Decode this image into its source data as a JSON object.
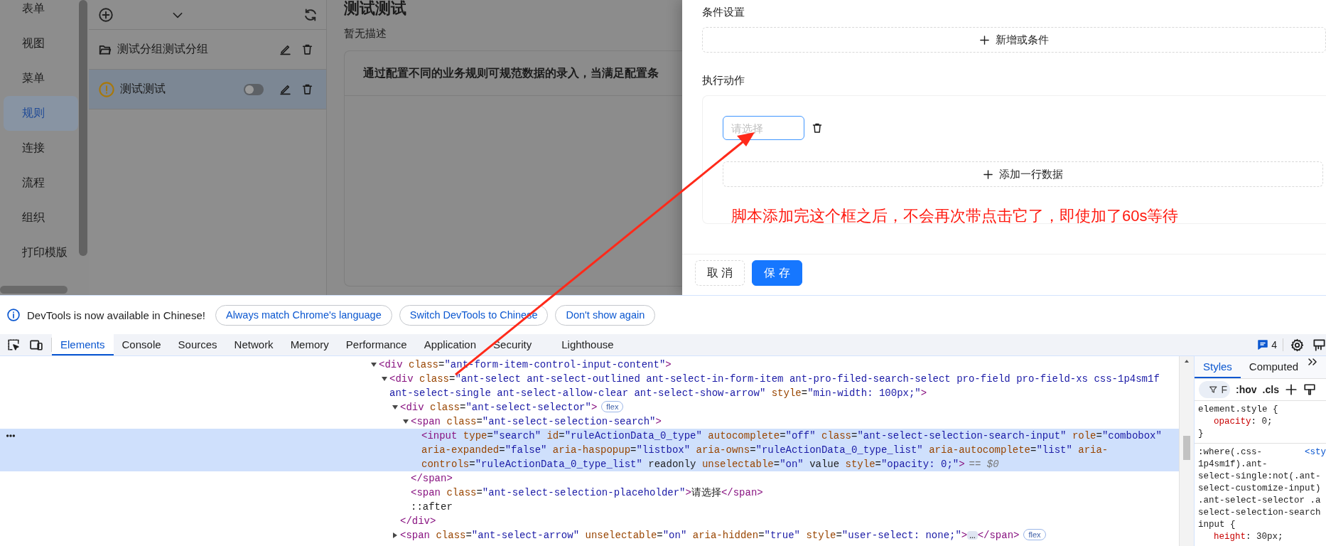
{
  "nav": {
    "items": [
      {
        "label": "表单",
        "selected": false
      },
      {
        "label": "视图",
        "selected": false
      },
      {
        "label": "菜单",
        "selected": false
      },
      {
        "label": "规则",
        "selected": true
      },
      {
        "label": "连接",
        "selected": false
      },
      {
        "label": "流程",
        "selected": false
      },
      {
        "label": "组织",
        "selected": false
      },
      {
        "label": "打印模版",
        "selected": false
      }
    ]
  },
  "rule_list": {
    "items": [
      {
        "kind": "group",
        "label": "测试分组测试分组",
        "selected": false
      },
      {
        "kind": "rule",
        "label": "测试测试",
        "selected": true,
        "enabled": false
      }
    ]
  },
  "rule": {
    "title": "测试测试",
    "description": "暂无描述",
    "notice": "通过配置不同的业务规则可规范数据的录入，当满足配置条"
  },
  "drawer": {
    "condition_label": "条件设置",
    "add_condition": "新增或条件",
    "action_label": "执行动作",
    "action_select": {
      "placeholder": "请选择"
    },
    "add_row": "添加一行数据",
    "cancel": "取 消",
    "save": "保 存"
  },
  "annotation": {
    "text": "脚本添加完这个框之后，不会再次带点击它了，即使加了60s等待"
  },
  "devtools": {
    "infobar": {
      "message": "DevTools is now available in Chinese!",
      "buttons": [
        "Always match Chrome's language",
        "Switch DevTools to Chinese",
        "Don't show again"
      ]
    },
    "tabs": [
      {
        "label": "Elements",
        "selected": true
      },
      {
        "label": "Console",
        "selected": false
      },
      {
        "label": "Sources",
        "selected": false
      },
      {
        "label": "Network",
        "selected": false
      },
      {
        "label": "Memory",
        "selected": false
      },
      {
        "label": "Performance",
        "selected": false
      },
      {
        "label": "Application",
        "selected": false
      },
      {
        "label": "Security",
        "selected": false
      },
      {
        "label": "Lighthouse",
        "selected": false
      }
    ],
    "issues_count": "4",
    "dom_tree": [
      {
        "text": "<div class=\"ant-form-item-control-input-content\">",
        "expanded": true,
        "selected": false,
        "children": [
          {
            "text": "<div class=\"ant-select ant-select-outlined ant-select-in-form-item ant-pro-filed-search-select pro-field pro-field-xs css-1p4sm1f ant-select-single ant-select-allow-clear ant-select-show-arrow\" style=\"min-width: 100px;\">",
            "expanded": true,
            "selected": false,
            "children": [
              {
                "text": "<div class=\"ant-select-selector\">",
                "badge": "flex",
                "expanded": true,
                "selected": false,
                "closing": "</div>",
                "children": [
                  {
                    "text": "<span class=\"ant-select-selection-search\">",
                    "expanded": true,
                    "selected": false,
                    "closing": "</span>",
                    "children": [
                      {
                        "text": "<input type=\"search\" id=\"ruleActionData_0_type\" autocomplete=\"off\" class=\"ant-select-selection-search-input\" role=\"combobox\" aria-expanded=\"false\" aria-haspopup=\"listbox\" aria-owns=\"ruleActionData_0_type_list\" aria-autocomplete=\"list\" aria-controls=\"ruleActionData_0_type_list\" readonly unselectable=\"on\" value style=\"opacity: 0;\">",
                        "suffix": "== $0",
                        "selected": true
                      }
                    ]
                  },
                  {
                    "text": "<span class=\"ant-select-selection-placeholder\">请选择</span>",
                    "selected": false
                  },
                  {
                    "text": "::after",
                    "selected": false
                  }
                ]
              },
              {
                "text": "<span class=\"ant-select-arrow\" unselectable=\"on\" aria-hidden=\"true\" style=\"user-select: none;\">",
                "expanded": false,
                "ellipsis": "…",
                "text_after": "</span>",
                "badge": "flex",
                "selected": false
              }
            ]
          }
        ]
      }
    ],
    "styles": {
      "tabs": [
        {
          "label": "Styles",
          "selected": true
        },
        {
          "label": "Computed",
          "selected": false
        }
      ],
      "filter_placeholder": "F",
      "hov": ":hov",
      "cls": ".cls",
      "rules": [
        {
          "selector_lines": [
            "element.style {"
          ],
          "declarations": [
            "opacity: 0;"
          ],
          "close": "}"
        },
        {
          "selector_lines": [
            ":where(.css-",
            "1p4sm1f).ant-",
            "select-single:not(.ant-",
            "select-customize-input)",
            ".ant-select-selector .a",
            "select-selection-search",
            "input {"
          ],
          "source": "<sty",
          "declarations": [
            "height: 30px;"
          ]
        }
      ]
    }
  }
}
